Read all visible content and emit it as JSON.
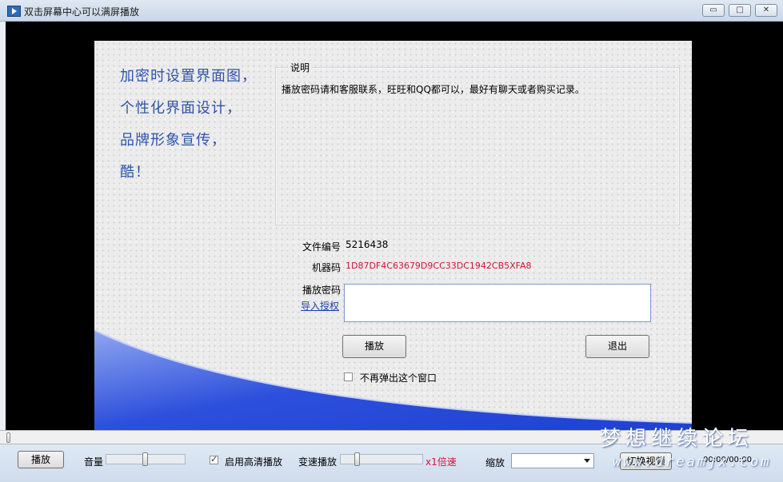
{
  "window": {
    "title": "双击屏幕中心可以满屏播放",
    "min_symbol": "▭",
    "max_symbol": "□",
    "close_symbol": "✕"
  },
  "panel": {
    "slogan": [
      "加密时设置界面图，",
      "个性化界面设计，",
      "品牌形象宣传，",
      "酷！"
    ],
    "group_title": "说明",
    "description": "播放密码请和客服联系，旺旺和QQ都可以，最好有聊天或者购买记录。",
    "file_no_label": "文件编号",
    "file_no_value": "5216438",
    "machine_label": "机器码",
    "machine_value": "1D87DF4C63679D9CC33DC1942CB5XFA8",
    "password_label": "播放密码",
    "import_label": "导入授权",
    "password_value": "",
    "play_button": "播放",
    "exit_button": "退出",
    "no_popup_label": "不再弹出这个窗口",
    "no_popup_checked": false
  },
  "controls": {
    "play_button": "播放",
    "volume_label": "音量",
    "volume_level": 0.5,
    "hd_label": "启用高清播放",
    "hd_checked": true,
    "speed_label": "变速播放",
    "speed_value": "x1倍速",
    "scale_label": "缩放",
    "scale_value": "",
    "switch_button": "切换视频",
    "time_display": "00:00/00:00"
  },
  "colors": {
    "slogan": "#2e55a8",
    "machine_code": "#d0163a",
    "speed_value": "#d0163a",
    "link": "#1f3fae"
  },
  "watermark": {
    "line1": "梦想继续论坛",
    "line2": "www.dreamjx.com"
  }
}
